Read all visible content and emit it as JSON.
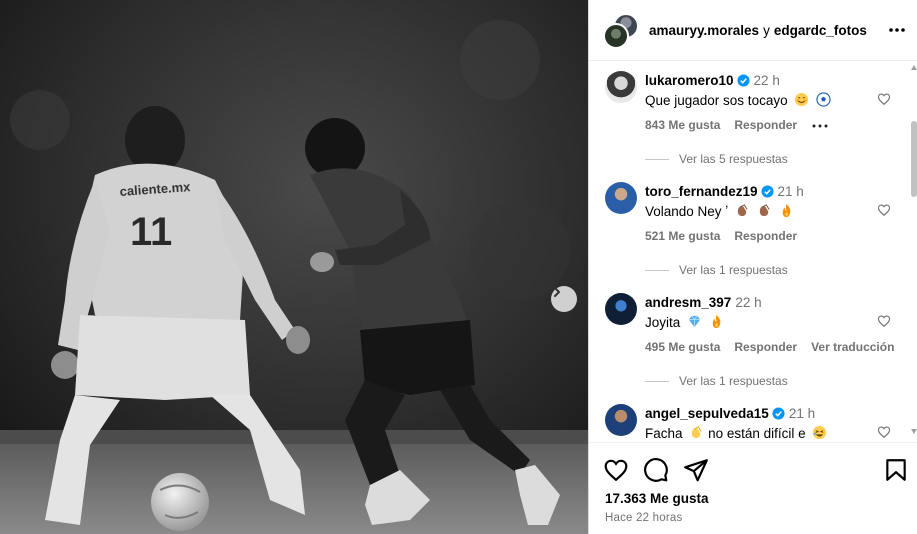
{
  "post": {
    "photo_alt_players": [
      "Player #11 in light jersey",
      "Player dribbling ball"
    ],
    "jersey_text": "caliente.mx",
    "jersey_number": "11"
  },
  "header": {
    "author1": "amauryy.morales",
    "conjunction": "y",
    "author2": "edgardc_fotos",
    "more_icon": "more-horizontal-icon"
  },
  "comments": [
    {
      "username": "lukaromero10",
      "verified": true,
      "time": "22 h",
      "text": "Que jugador sos tocayo",
      "emojis": [
        "smiling-face-emoji",
        "soccer-ball-emoji"
      ],
      "likes": "843 Me gusta",
      "reply_label": "Responder",
      "has_more": true,
      "replies": "Ver las 5 respuestas"
    },
    {
      "username": "toro_fernandez19",
      "verified": true,
      "time": "21 h",
      "text": "Volando Ney ʼ",
      "emojis": [
        "clapping-hands-emoji",
        "clapping-hands-emoji",
        "fire-emoji"
      ],
      "likes": "521 Me gusta",
      "reply_label": "Responder",
      "replies": "Ver las 1 respuestas"
    },
    {
      "username": "andresm_397",
      "verified": false,
      "time": "22 h",
      "text": "Joyita",
      "emojis": [
        "gem-emoji",
        "fire-emoji"
      ],
      "likes": "495 Me gusta",
      "reply_label": "Responder",
      "translate_label": "Ver traducción",
      "replies": "Ver las 1 respuestas"
    },
    {
      "username": "angel_sepulveda15",
      "verified": true,
      "time": "21 h",
      "text": "Facha",
      "text2": "no están difícil e",
      "emojis": [
        "clapping-hands-emoji",
        "laughing-emoji"
      ]
    }
  ],
  "actions": {
    "likes_total": "17.363 Me gusta",
    "posted": "Hace 22 horas"
  },
  "colors": {
    "verified": "#0095f6",
    "muted": "#737373",
    "border": "#dbdbdb"
  }
}
